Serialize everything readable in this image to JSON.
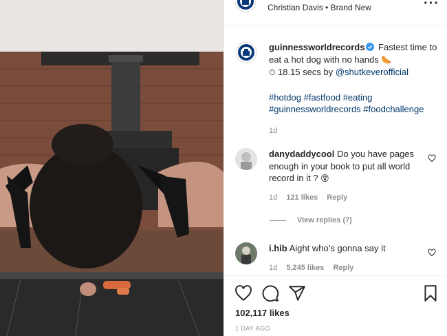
{
  "post": {
    "account": "guinnessworldrecords",
    "header_subtitle": "Christian Davis • Brand New",
    "caption_text": "Fastest time to eat a hot dog with no hands",
    "caption_emoji_food": "🌭",
    "caption_emoji_timer": "⏱",
    "caption_time": "18.15 secs by",
    "caption_mention": "@shutkeverofficial",
    "hashtags": "#hotdog #fastfood #eating #guinnessworldrecords #foodchallenge",
    "caption_age": "1d",
    "likes": "102,117 likes",
    "time_ago": "1 DAY AGO"
  },
  "comments": [
    {
      "username": "danydaddycool",
      "text": "Do you have pages enough in your book to put all world record in it ?",
      "emoji": "😵",
      "age": "1d",
      "likes": "121 likes",
      "reply": "Reply",
      "view_replies": "View replies (7)"
    },
    {
      "username": "i.hib",
      "text": "Aight who’s gonna say it",
      "age": "1d",
      "likes": "5,245 likes",
      "reply": "Reply"
    }
  ],
  "icons": [
    "more-icon",
    "verified-icon",
    "heart-icon",
    "comment-icon",
    "share-icon",
    "bookmark-icon",
    "comment-like-icon"
  ],
  "colors": {
    "link": "#00376b",
    "verified": "#3897f0",
    "muted": "#8e8e8e",
    "text": "#262626"
  }
}
